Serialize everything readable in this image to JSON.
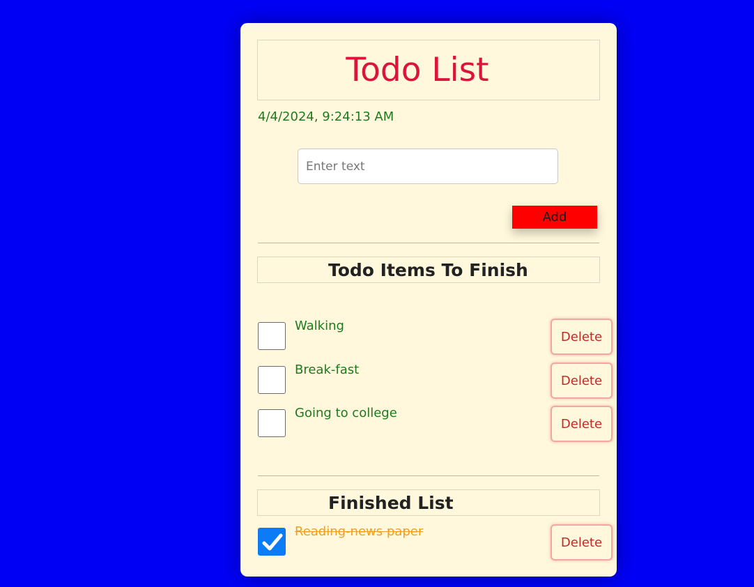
{
  "header": {
    "title": "Todo List",
    "datetime": "4/4/2024, 9:24:13 AM"
  },
  "input": {
    "placeholder": "Enter text",
    "value": ""
  },
  "add_label": "Add",
  "todo_section": {
    "title": "Todo Items To Finish",
    "items": [
      {
        "label": "Walking",
        "checked": false,
        "delete_label": "Delete"
      },
      {
        "label": "Break-fast",
        "checked": false,
        "delete_label": "Delete"
      },
      {
        "label": "Going to college",
        "checked": false,
        "delete_label": "Delete"
      }
    ]
  },
  "finished_section": {
    "title": "Finished List",
    "items": [
      {
        "label": "Reading-news paper",
        "checked": true,
        "delete_label": "Delete"
      }
    ]
  },
  "colors": {
    "background": "#0000f5",
    "card": "#fff8dc",
    "title": "#dc143c",
    "item_text": "#1f7a1f",
    "finished_text": "#f0a020",
    "add_button": "#ff0000",
    "checkbox_checked": "#0b7cf5"
  }
}
